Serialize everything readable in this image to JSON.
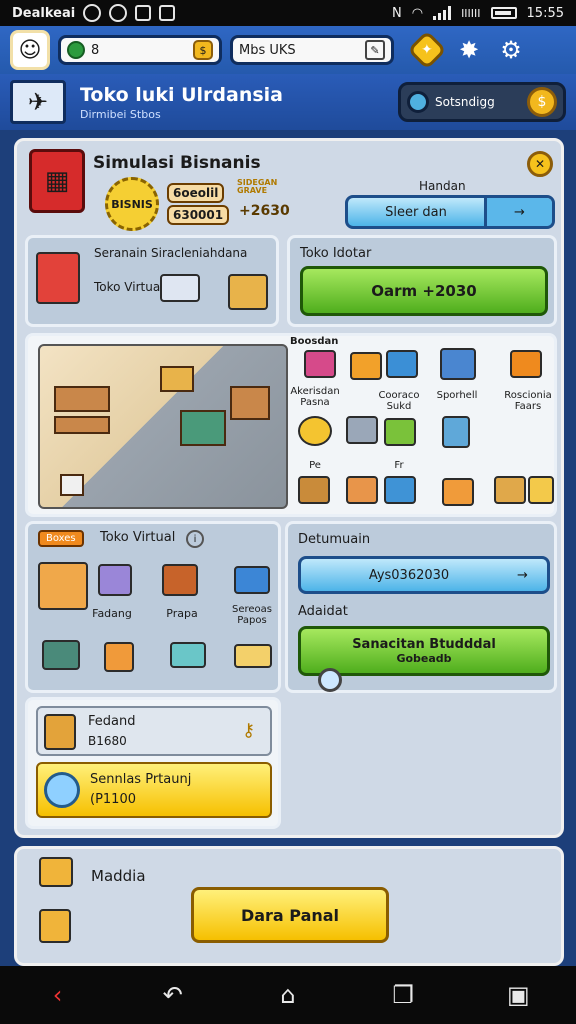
{
  "status": {
    "carrier": "Dealkeai",
    "time": "15:55",
    "battery_label": "IIIIII"
  },
  "topbar": {
    "field_one": "8",
    "field_two": "Mbs UKS"
  },
  "banner": {
    "title": "Toko luki Ulrdansia",
    "subtitle": "Dirmibei Stbos",
    "settings_label": "Sotsndigg"
  },
  "main": {
    "title": "Simulasi Bisnanis",
    "seal_text": "BISNIS",
    "stat_one": "6oeolil",
    "stat_two": "630001",
    "stat_gold_small": "SIDEGAN GRAVE",
    "stat_gold_value": "+2630",
    "right_label": "Handan",
    "blue_button_label": "Sleer dan",
    "blue_button_arrow": "→",
    "store_panel_title": "Seranain Siracleniahdana",
    "store_panel_label": "Toko Virtual",
    "sale_panel_title": "Toko Idotar",
    "earn_button": "Oarm +2030",
    "items_header": "Boosdan",
    "items": [
      {
        "label": "Akerisdan Pasna"
      },
      {
        "label": ""
      },
      {
        "label": "Cooraco Sukd"
      },
      {
        "label": "Sporhell"
      },
      {
        "label": "Roscionia Faars"
      },
      {
        "label": ""
      },
      {
        "label": ""
      },
      {
        "label": ""
      },
      {
        "label": ""
      },
      {
        "label": "Pe"
      },
      {
        "label": "Fr"
      }
    ],
    "virtual_panel": {
      "tag": "Boxes",
      "title": "Toko Virtual",
      "items": [
        "Fadang",
        "Prapa",
        "Sereoas Papos"
      ]
    },
    "right_panel": {
      "title": "Detumuain",
      "value_button": "Ays0362030",
      "section_title": "Adaidat",
      "green_line_one": "Sanacitan Btudddal",
      "green_line_two": "Gobeadb"
    },
    "small_card_one": {
      "title": "Fedand",
      "value": "B1680"
    },
    "small_card_two": {
      "title": "Sennlas Prtaunj",
      "value": "(P1100"
    }
  },
  "bottom": {
    "label": "Maddia",
    "button": "Dara Panal"
  },
  "colors": {
    "brand_blue": "#2f67c4",
    "green": "#4fae1d",
    "yellow": "#f6c000",
    "red": "#d62b2b"
  },
  "icons": [
    "avatar-icon",
    "gem-icon",
    "coin-icon",
    "edit-icon",
    "hex-badge-icon",
    "mascot-icon",
    "gear-icon",
    "plane-icon",
    "search-icon",
    "back-icon",
    "home-icon",
    "recents-icon"
  ]
}
